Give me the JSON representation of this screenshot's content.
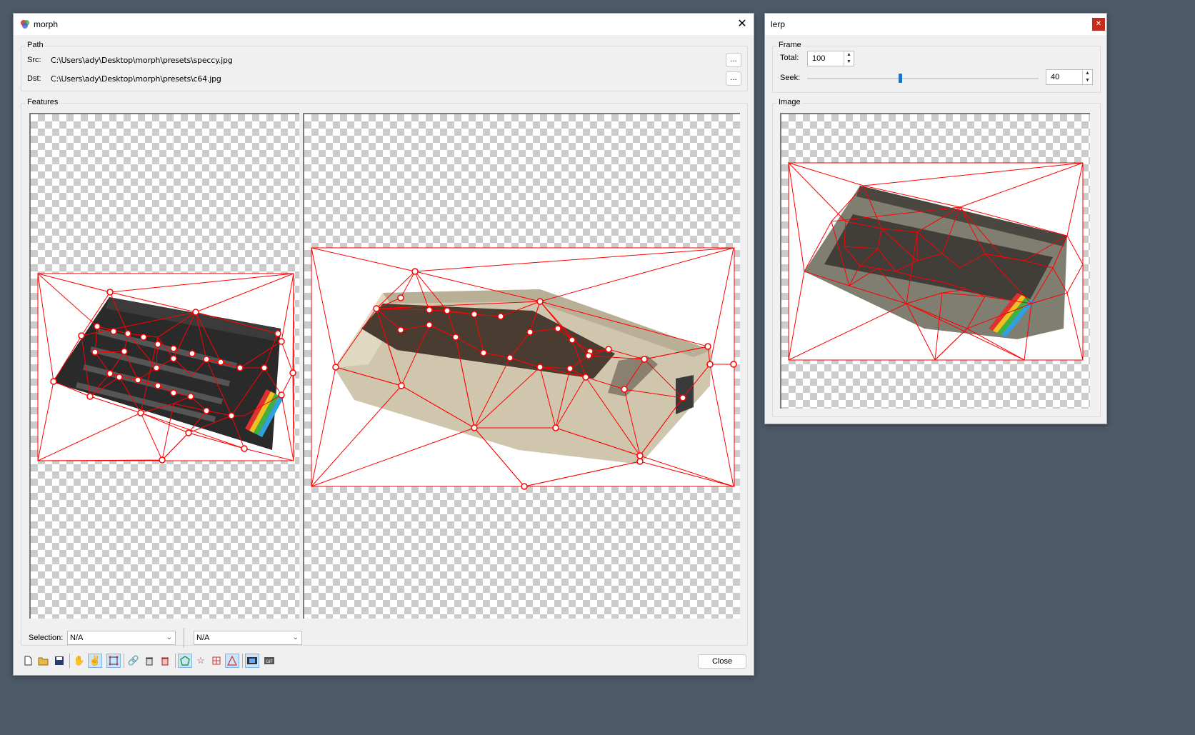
{
  "morph": {
    "title": "morph",
    "path_group": "Path",
    "src_label": "Src:",
    "src_value": "C:\\Users\\ady\\Desktop\\morph\\presets\\speccy.jpg",
    "dst_label": "Dst:",
    "dst_value": "C:\\Users\\ady\\Desktop\\morph\\presets\\c64.jpg",
    "browse_label": "...",
    "features_group": "Features",
    "selection_label": "Selection:",
    "selection_src": "N/A",
    "selection_dst": "N/A",
    "close_label": "Close",
    "toolbar_icons": [
      "new-icon",
      "open-icon",
      "save-icon",
      "hand-icon",
      "add-point-icon",
      "bounds-icon",
      "link-icon",
      "delete-all-icon",
      "trash-icon",
      "polygon-icon",
      "star-icon",
      "mesh-icon",
      "triangulate-icon",
      "film-icon",
      "gif-icon"
    ]
  },
  "lerp": {
    "title": "lerp",
    "frame_group": "Frame",
    "total_label": "Total:",
    "total_value": "100",
    "seek_label": "Seek:",
    "seek_value": "40",
    "seek_fraction": 0.4,
    "image_group": "Image"
  },
  "colors": {
    "desktop": "#4d5a68",
    "mesh": "#ff0000",
    "close_red": "#c42b1c"
  }
}
